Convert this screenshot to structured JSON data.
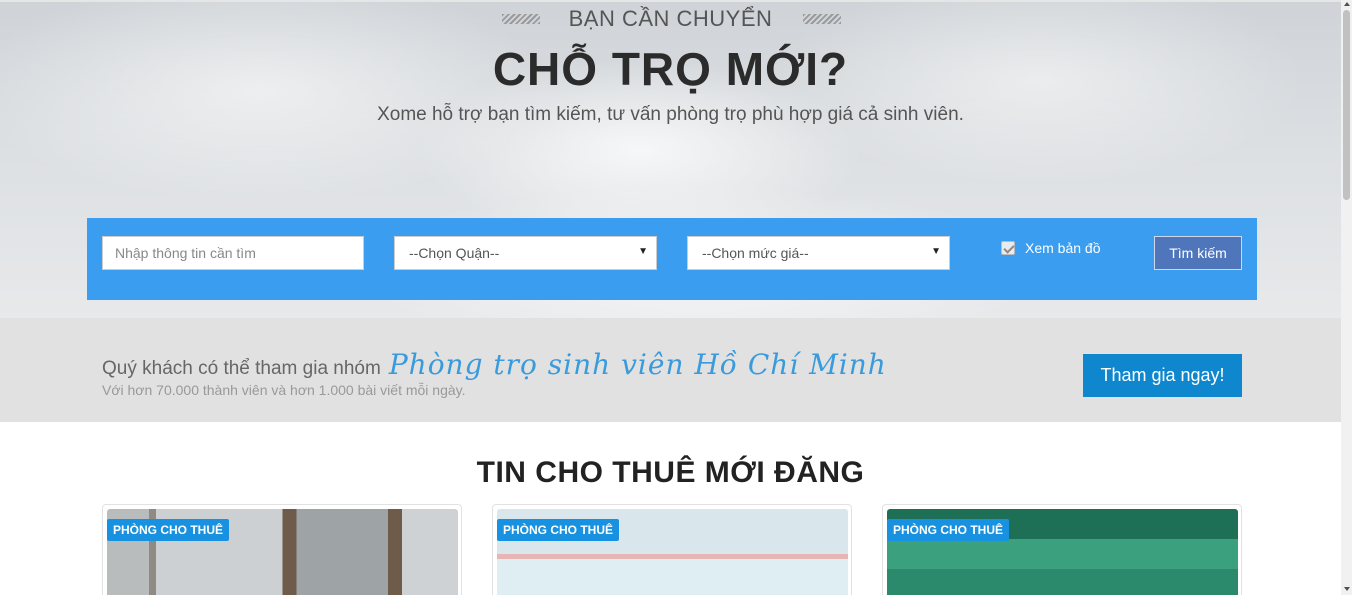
{
  "hero": {
    "eyebrow": "BẠN CẦN CHUYỂN",
    "headline": "CHỖ TRỌ MỚI?",
    "subline": "Xome hỗ trợ bạn tìm kiếm, tư vấn phòng trọ phù hợp giá cả sinh viên."
  },
  "search": {
    "placeholder": "Nhập thông tin cần tìm",
    "district_selected": "--Chọn Quận--",
    "price_selected": "--Chọn mức giá--",
    "map_label": "Xem bản đồ",
    "map_checked": true,
    "button_label": "Tìm kiếm"
  },
  "join": {
    "lead": "Quý khách có thể tham gia nhóm",
    "group": "Phòng trọ sinh viên Hồ Chí Minh",
    "sub": "Với hơn 70.000 thành viên và hơn 1.000 bài viết mỗi ngày.",
    "button_label": "Tham gia ngay!"
  },
  "listings": {
    "title": "TIN CHO THUÊ MỚI ĐĂNG",
    "cards": [
      {
        "badge": "PHÒNG CHO THUÊ"
      },
      {
        "badge": "PHÒNG CHO THUÊ"
      },
      {
        "badge": "PHÒNG CHO THUÊ"
      }
    ]
  },
  "colors": {
    "search_bar": "#3a9df0",
    "join_button": "#0e87cf",
    "search_button": "#4f76bb",
    "badge": "#1892e0"
  }
}
